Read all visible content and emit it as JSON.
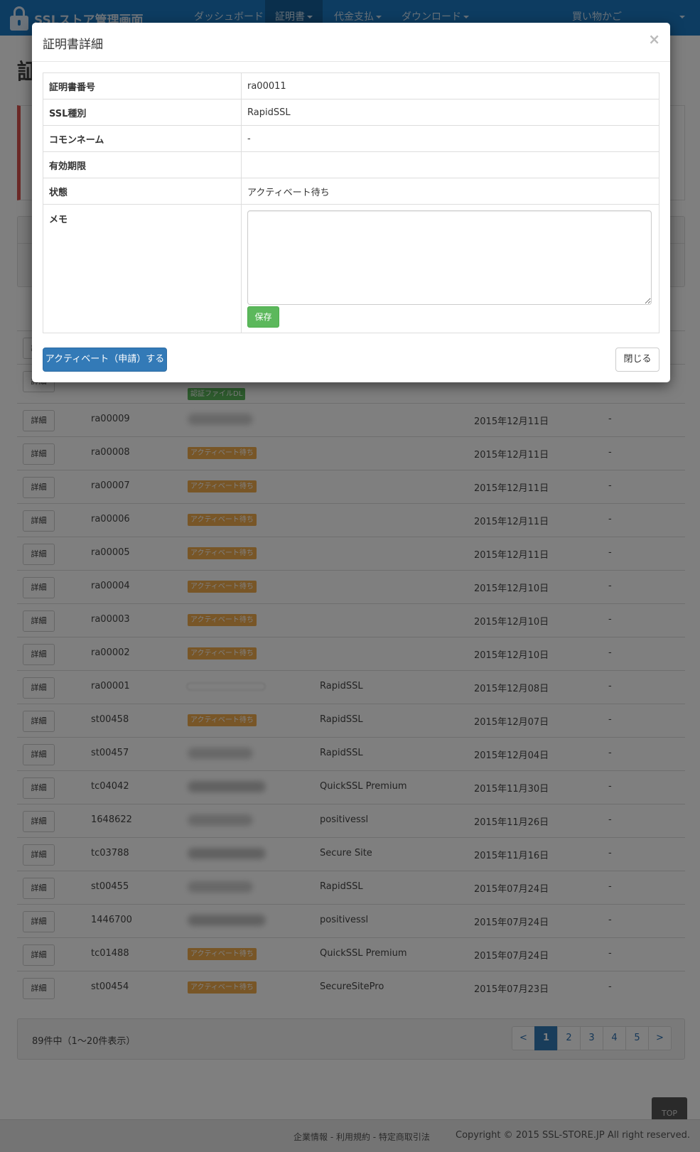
{
  "navbar": {
    "brand": "SSLストア管理画面",
    "items": [
      {
        "label": "ダッシュボード"
      },
      {
        "label": "証明書"
      },
      {
        "label": "代金支払"
      },
      {
        "label": "ダウンロード"
      }
    ],
    "cart": "買い物かご",
    "brand_color": "#1a78c2"
  },
  "modal": {
    "title": "証明書詳細",
    "close_symbol": "×",
    "fields": [
      {
        "label": "証明書番号",
        "value": "ra00011"
      },
      {
        "label": "SSL種別",
        "value": "RapidSSL"
      },
      {
        "label": "コモンネーム",
        "value": "-"
      },
      {
        "label": "有効期限",
        "value": ""
      },
      {
        "label": "状態",
        "value": "アクティベート待ち"
      }
    ],
    "memo_label": "メモ",
    "memo_value": "",
    "save_label": "保存",
    "activate_label": "アクティベート（申請）する",
    "close_label": "閉じる"
  },
  "table": {
    "detail_label": "詳細",
    "status_pending": "アクティベート待ち",
    "status_auth_dl": "認証ファイルDL",
    "rows": [
      {
        "no": "ra00009",
        "type": "",
        "date": "2015年12月11日",
        "expiry": "-"
      },
      {
        "no": "ra00008",
        "type": "",
        "date": "2015年12月11日",
        "expiry": "-"
      },
      {
        "no": "ra00007",
        "type": "",
        "date": "2015年12月11日",
        "expiry": "-"
      },
      {
        "no": "ra00006",
        "type": "",
        "date": "2015年12月11日",
        "expiry": "-"
      },
      {
        "no": "ra00005",
        "type": "",
        "date": "2015年12月11日",
        "expiry": "-"
      },
      {
        "no": "ra00004",
        "type": "",
        "date": "2015年12月10日",
        "expiry": "-"
      },
      {
        "no": "ra00003",
        "type": "",
        "date": "2015年12月10日",
        "expiry": "-"
      },
      {
        "no": "ra00002",
        "type": "",
        "date": "2015年12月10日",
        "expiry": "-"
      },
      {
        "no": "ra00001",
        "type": "RapidSSL",
        "date": "2015年12月08日",
        "expiry": "-"
      },
      {
        "no": "st00458",
        "type": "RapidSSL",
        "date": "2015年12月07日",
        "expiry": "-"
      },
      {
        "no": "st00457",
        "type": "RapidSSL",
        "date": "2015年12月04日",
        "expiry": "-"
      },
      {
        "no": "tc04042",
        "type": "QuickSSL Premium",
        "date": "2015年11月30日",
        "expiry": "-"
      },
      {
        "no": "1648622",
        "type": "positivessl",
        "date": "2015年11月26日",
        "expiry": "-"
      },
      {
        "no": "tc03788",
        "type": "Secure Site",
        "date": "2015年11月16日",
        "expiry": "-"
      },
      {
        "no": "st00455",
        "type": "RapidSSL",
        "date": "2015年07月24日",
        "expiry": "-"
      },
      {
        "no": "1446700",
        "type": "positivessl",
        "date": "2015年07月24日",
        "expiry": "-"
      },
      {
        "no": "tc01488",
        "type": "QuickSSL Premium",
        "date": "2015年07月24日",
        "expiry": "-"
      },
      {
        "no": "st00454",
        "type": "SecureSitePro",
        "date": "2015年07月23日",
        "expiry": "-"
      }
    ]
  },
  "pagination": {
    "summary": "89件中（1〜20件表示）",
    "prev": "<",
    "pages": [
      "1",
      "2",
      "3",
      "4",
      "5"
    ],
    "next": ">",
    "current": "1"
  },
  "top_button": "TOP",
  "footer": {
    "links": "企業情報 - 利用規約 - 特定商取引法",
    "copyright": "Copyright © 2015 SSL-STORE.JP All right reserved."
  }
}
